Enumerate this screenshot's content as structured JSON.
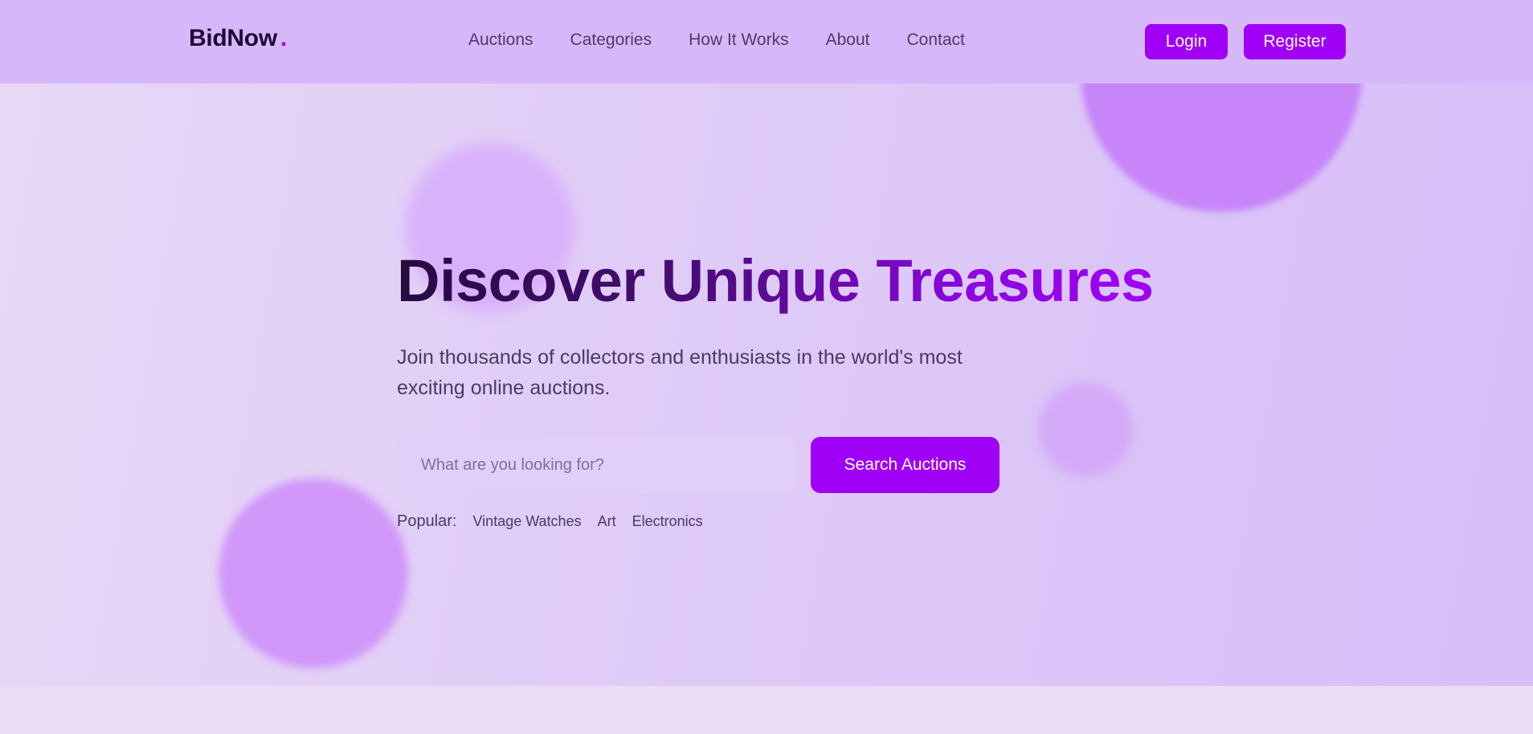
{
  "header": {
    "logo": "BidNow",
    "logo_dot": ".",
    "nav": [
      "Auctions",
      "Categories",
      "How It Works",
      "About",
      "Contact"
    ],
    "login_label": "Login",
    "register_label": "Register"
  },
  "hero": {
    "title": "Discover Unique Treasures",
    "subtitle": "Join thousands of collectors and enthusiasts in the world's most exciting online auctions.",
    "search": {
      "placeholder": "What are you looking for?",
      "value": "",
      "button_label": "Search Auctions"
    },
    "popular": {
      "label": "Popular:",
      "tags": [
        "Vintage Watches",
        "Art",
        "Electronics"
      ]
    }
  },
  "colors": {
    "accent": "#a000f6",
    "header_bg": "#d6b8fa",
    "title_dark": "#260a3f",
    "text_muted": "#4b3a62"
  }
}
